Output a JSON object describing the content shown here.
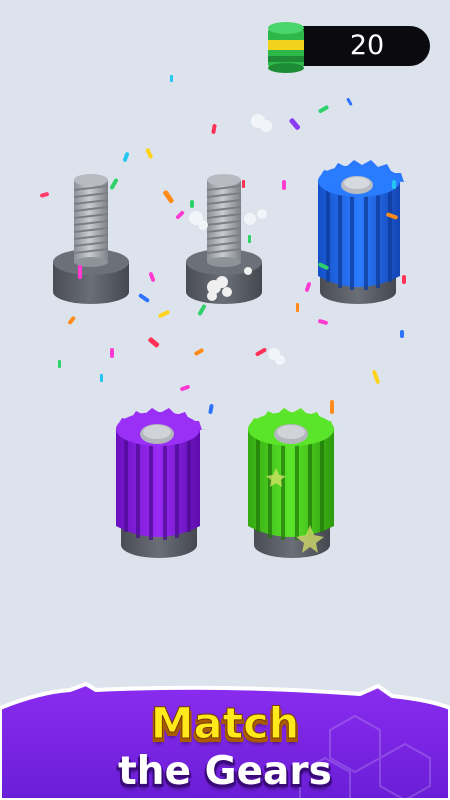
{
  "hud": {
    "coin_icon": "gear-coin-stack-icon",
    "coin_count": "20"
  },
  "banner": {
    "line1": "Match",
    "line2": "the Gears"
  },
  "board": {
    "bolts": [
      {
        "id": "bolt-1",
        "state": "empty"
      },
      {
        "id": "bolt-2",
        "state": "empty"
      },
      {
        "id": "bolt-3",
        "state": "gear",
        "gear_color": "blue"
      },
      {
        "id": "bolt-4",
        "state": "gear",
        "gear_color": "purple"
      },
      {
        "id": "bolt-5",
        "state": "gear",
        "gear_color": "green"
      }
    ]
  },
  "colors": {
    "background": "#dde3ed",
    "gear_blue": "#1f6ff0",
    "gear_purple": "#8a16e8",
    "gear_green": "#49d51b",
    "base_gray": "#5c5f66",
    "banner_purple": "#7b24e6",
    "title_yellow": "#ffe91a"
  }
}
